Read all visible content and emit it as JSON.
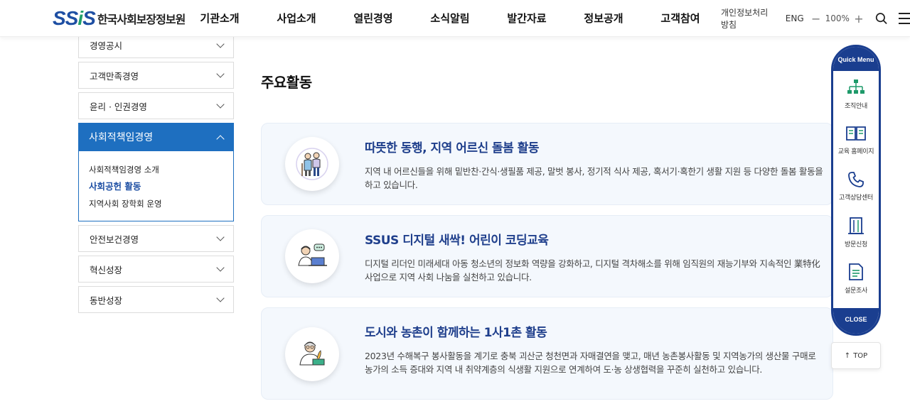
{
  "brand": {
    "mark_left": "SS",
    "mark_mid": "i",
    "mark_right": "S",
    "name": "한국사회보장정보원",
    "primary": "#1e4fa3",
    "accent": "#21a06a"
  },
  "gnb": [
    "기관소개",
    "사업소개",
    "열린경영",
    "소식알림",
    "발간자료",
    "정보공개",
    "고객참여"
  ],
  "util": {
    "privacy": "개인정보처리방침",
    "lang": "ENG",
    "zoom_out": "−",
    "zoom": "100%",
    "zoom_in": "+",
    "search_icon": "search-icon",
    "menu_icon": "hamburger-menu-icon"
  },
  "sidebar": {
    "items_top": [
      "경영공시",
      "고객만족경영",
      "윤리 · 인권경영"
    ],
    "active": "사회적책임경영",
    "sub": [
      "사회적책임경영 소개",
      "사회공헌 활동",
      "지역사회 장학회 운영"
    ],
    "active_sub_index": 1,
    "items_bottom": [
      "안전보건경영",
      "혁신성장",
      "동반성장"
    ],
    "active_color": "#1e6fc0"
  },
  "main": {
    "title": "주요활동",
    "cards": [
      {
        "title": "따뜻한 동행, 지역 어르신 돌봄 활동",
        "desc": "지역 내 어르신들을 위해 밑반찬·간식·생필품 제공, 말벗 봉사, 정기적 식사 제공, 혹서기·혹한기 생활 지원 등 다양한 돌봄 활동을 하고 있습니다.",
        "icon": "elderly-couple-icon"
      },
      {
        "title": "SSUS 디지털 새싹! 어린이 코딩교육",
        "desc": "디지털 리더인 미래세대 아동 청소년의 정보화 역량을 강화하고, 디지털 격차해소를 위해 임직원의 재능기부와 지속적인 業特化 사업으로 지역 사회 나눔을 실천하고 있습니다.",
        "icon": "coding-teacher-icon"
      },
      {
        "title": "도시와 농촌이 함께하는 1사1촌 활동",
        "desc": "2023년 수해복구 봉사활동을 계기로 충북 괴산군 청천면과 자매결연을 맺고, 매년 농촌봉사활동 및 지역농가의 생산물 구매로 농가의 소득 증대와 지역 내 취약계층의 식생활 지원으로 연계하여 도·농 상생협력을 꾸준히 실천하고 있습니다.",
        "icon": "farmer-icon"
      }
    ]
  },
  "quick_menu": {
    "title": "Quick Menu",
    "items": [
      {
        "label": "조직안내",
        "icon": "org-chart-icon"
      },
      {
        "label": "교육 홈페이지",
        "icon": "book-icon"
      },
      {
        "label": "고객상담센터",
        "icon": "phone-icon"
      },
      {
        "label": "방문신청",
        "icon": "building-icon"
      },
      {
        "label": "설문조사",
        "icon": "document-icon"
      }
    ],
    "close": "CLOSE",
    "color": "#1a3e8f"
  },
  "top_button": {
    "arrow": "↑",
    "label": "TOP"
  }
}
